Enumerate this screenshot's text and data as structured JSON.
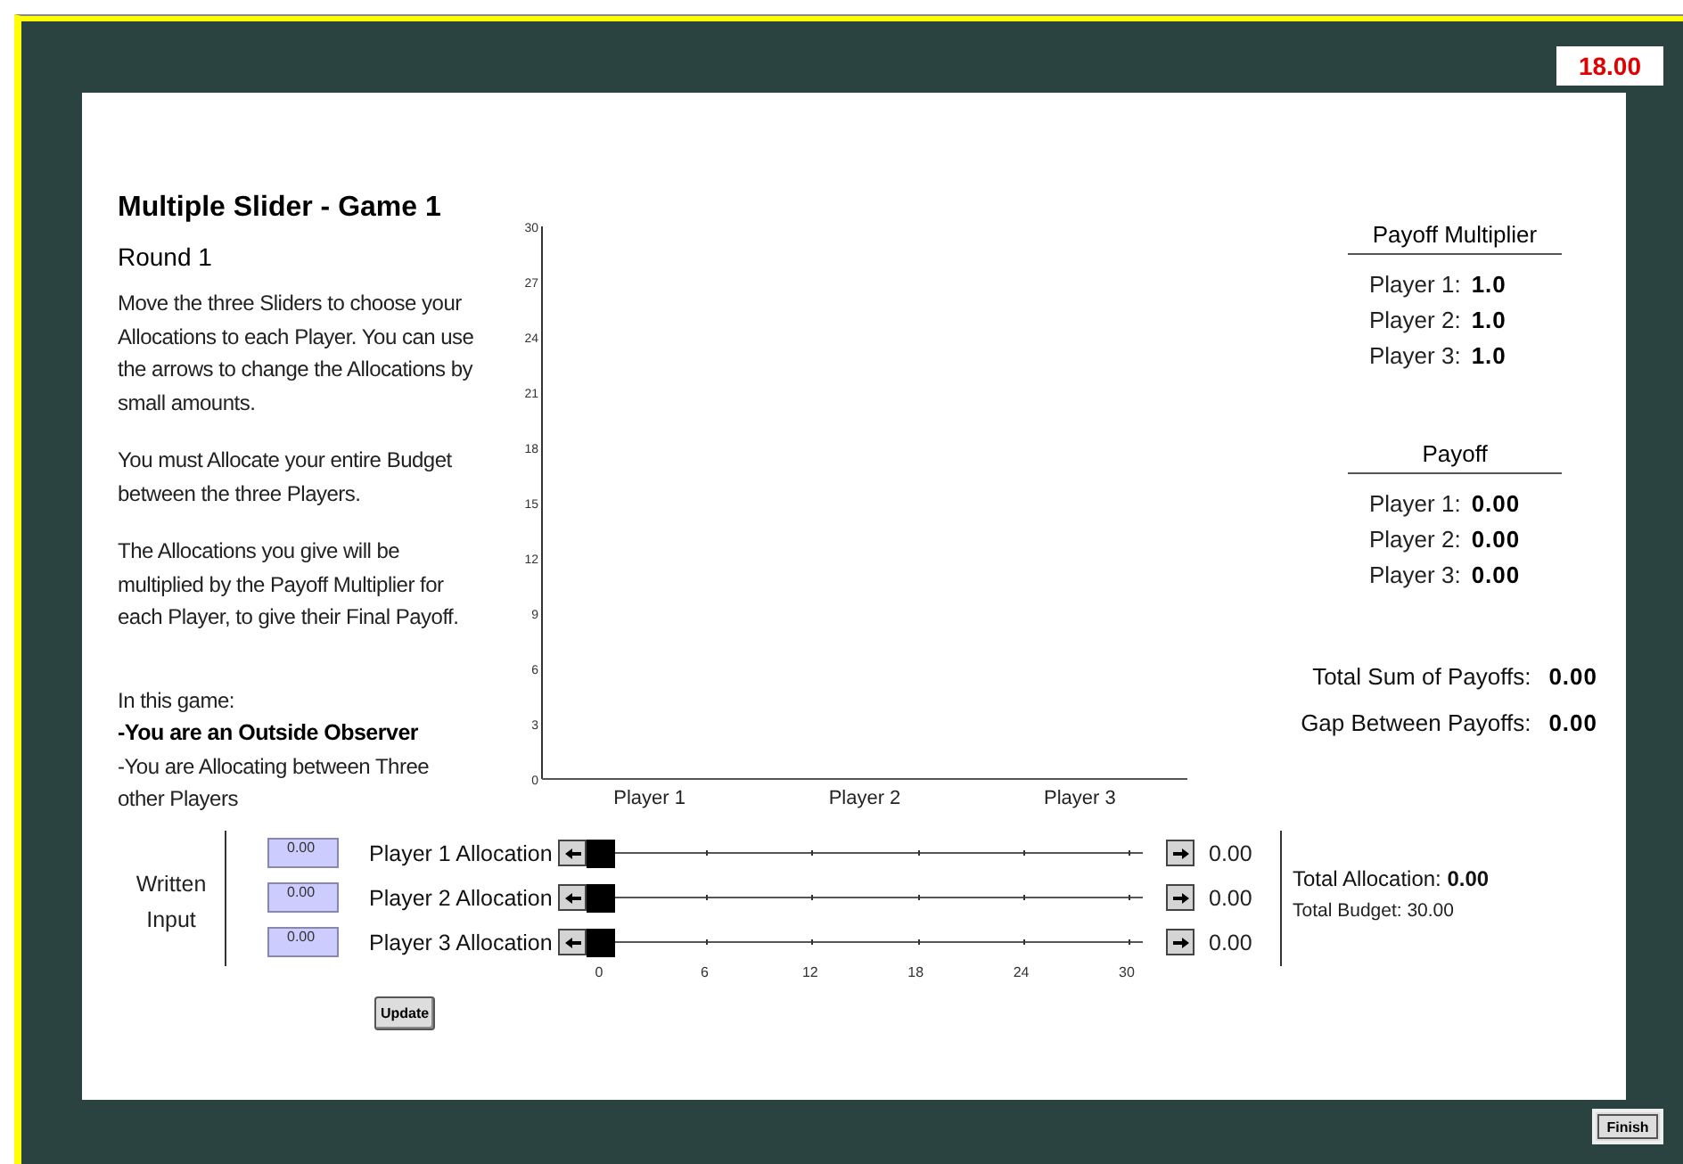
{
  "timer": "18.00",
  "title": "Multiple Slider - Game 1",
  "round": "Round 1",
  "instructions": [
    "Move the three Sliders to choose your Allocations to each Player. You can use the arrows to change the Allocations by small amounts.",
    "You must Allocate your entire Budget between the three Players.",
    "The Allocations you give will be multiplied by the Payoff Multiplier for each Player, to give their Final Payoff."
  ],
  "game_info": {
    "heading": "In this game:",
    "lines": [
      {
        "text": "-You are an Outside Observer",
        "kind": "bold"
      },
      {
        "text": "-You are Allocating between Three other Players",
        "kind": "plain"
      }
    ]
  },
  "chart": {
    "chart_data": {
      "type": "bar",
      "categories": [
        "Player 1",
        "Player 2",
        "Player 3"
      ],
      "values": [
        0,
        0,
        0
      ],
      "ylim": [
        0,
        30
      ],
      "yticks": [
        0,
        3,
        6,
        9,
        12,
        15,
        18,
        21,
        24,
        27,
        30
      ]
    }
  },
  "multiplier": {
    "heading": "Payoff Multiplier",
    "rows": [
      {
        "label": "Player 1:",
        "value": "1.0"
      },
      {
        "label": "Player 2:",
        "value": "1.0"
      },
      {
        "label": "Player 3:",
        "value": "1.0"
      }
    ]
  },
  "payoff": {
    "heading": "Payoff",
    "rows": [
      {
        "label": "Player 1:",
        "value": "0.00"
      },
      {
        "label": "Player 2:",
        "value": "0.00"
      },
      {
        "label": "Player 3:",
        "value": "0.00"
      }
    ]
  },
  "totals": [
    {
      "label": "Total Sum of Payoffs:",
      "value": "0.00"
    },
    {
      "label": "Gap Between Payoffs:",
      "value": "0.00"
    }
  ],
  "written_input": "Written Input",
  "allocations": [
    {
      "input": "0.00",
      "label": "Player 1 Allocation",
      "level": 0,
      "reading": "0.00"
    },
    {
      "input": "0.00",
      "label": "Player 2 Allocation",
      "level": 0,
      "reading": "0.00"
    },
    {
      "input": "0.00",
      "label": "Player 3 Allocation",
      "level": 0,
      "reading": "0.00"
    }
  ],
  "slider_scale": [
    "0",
    "6",
    "12",
    "18",
    "24",
    "30"
  ],
  "update_button": "Update",
  "total_allocation": {
    "label": "Total Allocation:",
    "value": "0.00"
  },
  "total_budget": "Total Budget: 30.00",
  "finish_button": "Finish"
}
